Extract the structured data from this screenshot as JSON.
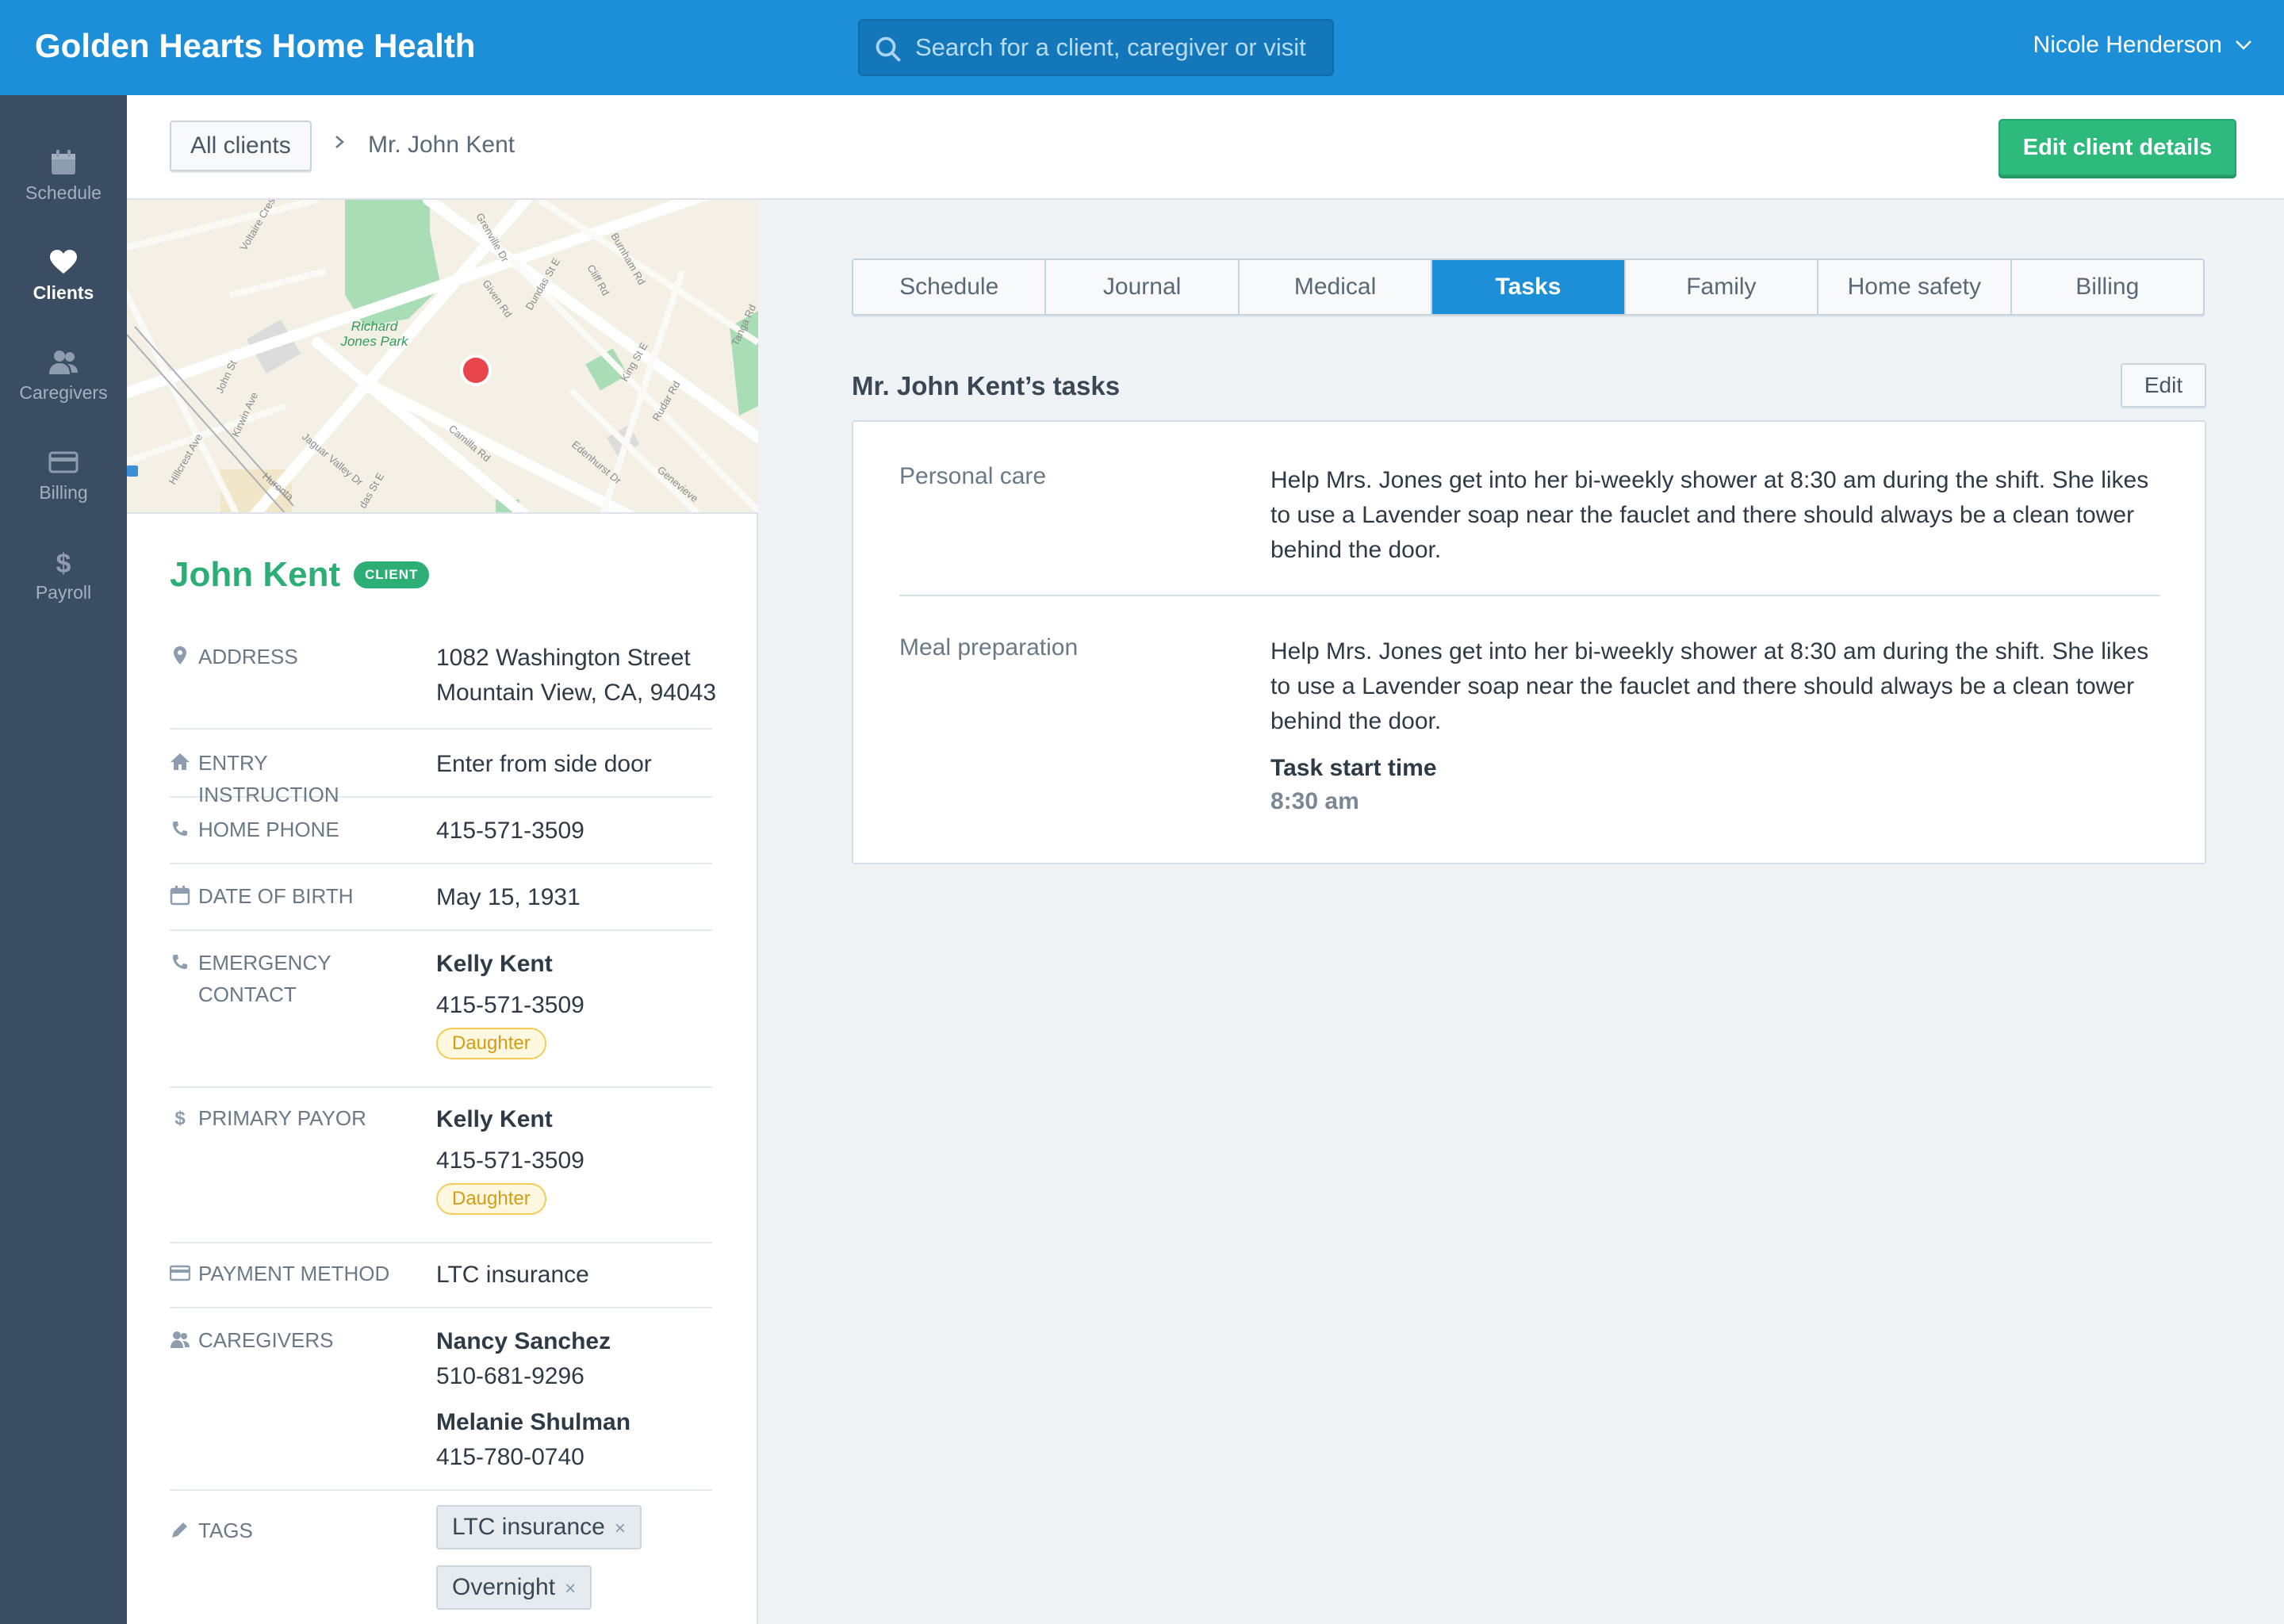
{
  "app": {
    "title": "Golden Hearts Home Health"
  },
  "search": {
    "placeholder": "Search for a client, caregiver or visit"
  },
  "user": {
    "name": "Nicole Henderson"
  },
  "sidebar": {
    "items": [
      {
        "label": "Schedule",
        "icon": "calendar-icon"
      },
      {
        "label": "Clients",
        "icon": "heart-icon"
      },
      {
        "label": "Caregivers",
        "icon": "people-icon"
      },
      {
        "label": "Billing",
        "icon": "card-icon"
      },
      {
        "label": "Payroll",
        "icon": "dollar-icon"
      }
    ],
    "active": "Clients"
  },
  "breadcrumb": {
    "all_clients": "All clients",
    "current": "Mr. John Kent"
  },
  "header": {
    "edit_client_label": "Edit client details"
  },
  "map": {
    "park_label_1": "Richard",
    "park_label_2": "Jones Park",
    "streets": [
      "Voltaire Cres",
      "John St",
      "Kirwin Ave",
      "Jaguar Valley Dr",
      "Hillcrest Ave",
      "Huronta",
      "Grenville Dr",
      "Given Rd",
      "Dundas St E",
      "Cliff Rd",
      "Burnham Rd",
      "Camilla Rd",
      "King St E",
      "Rudar Rd",
      "Edenhurst Dr",
      "Genevieve",
      "Tanga Rd",
      "das St E"
    ]
  },
  "client": {
    "name": "John Kent",
    "badge": "CLIENT",
    "address_label": "ADDRESS",
    "address_line1": "1082 Washington Street",
    "address_line2": "Mountain View, CA, 94043",
    "entry_label": "ENTRY INSTRUCTION",
    "entry_value": "Enter from side door",
    "phone_label": "HOME PHONE",
    "phone_value": "415-571-3509",
    "dob_label": "DATE OF BIRTH",
    "dob_value": "May 15, 1931",
    "emergency_label_1": "EMERGENCY",
    "emergency_label_2": "CONTACT",
    "emergency_name": "Kelly Kent",
    "emergency_phone": "415-571-3509",
    "emergency_relation": "Daughter",
    "payor_label": "PRIMARY PAYOR",
    "payor_name": "Kelly Kent",
    "payor_phone": "415-571-3509",
    "payor_relation": "Daughter",
    "payment_label": "PAYMENT METHOD",
    "payment_value": "LTC insurance",
    "caregivers_label": "CAREGIVERS",
    "caregivers": [
      {
        "name": "Nancy Sanchez",
        "phone": "510-681-9296"
      },
      {
        "name": "Melanie Shulman",
        "phone": "415-780-0740"
      }
    ],
    "tags_label": "TAGS",
    "tags": [
      "LTC insurance",
      "Overnight"
    ],
    "tag_remove": "×"
  },
  "tabs": {
    "items": [
      "Schedule",
      "Journal",
      "Medical",
      "Tasks",
      "Family",
      "Home safety",
      "Billing"
    ],
    "active": "Tasks"
  },
  "tasks": {
    "title": "Mr. John Kent’s tasks",
    "edit_label": "Edit",
    "items": [
      {
        "name": "Personal care",
        "description": "Help Mrs. Jones get into her bi-weekly shower at 8:30 am during the shift. She likes to use a Lavender soap near the fauclet and there should always be a clean tower behind the door."
      },
      {
        "name": "Meal preparation",
        "description": "Help Mrs. Jones get into her bi-weekly shower at 8:30 am during the shift. She likes to use a Lavender soap near the fauclet and there should always be a clean tower behind the door.",
        "start_label": "Task start time",
        "start_value": "8:30 am"
      }
    ]
  },
  "colors": {
    "primary": "#1c8fd8",
    "sidebar": "#3b4d63",
    "success": "#2dba7c",
    "client_green": "#2dae76",
    "warning": "#f3cc59"
  }
}
